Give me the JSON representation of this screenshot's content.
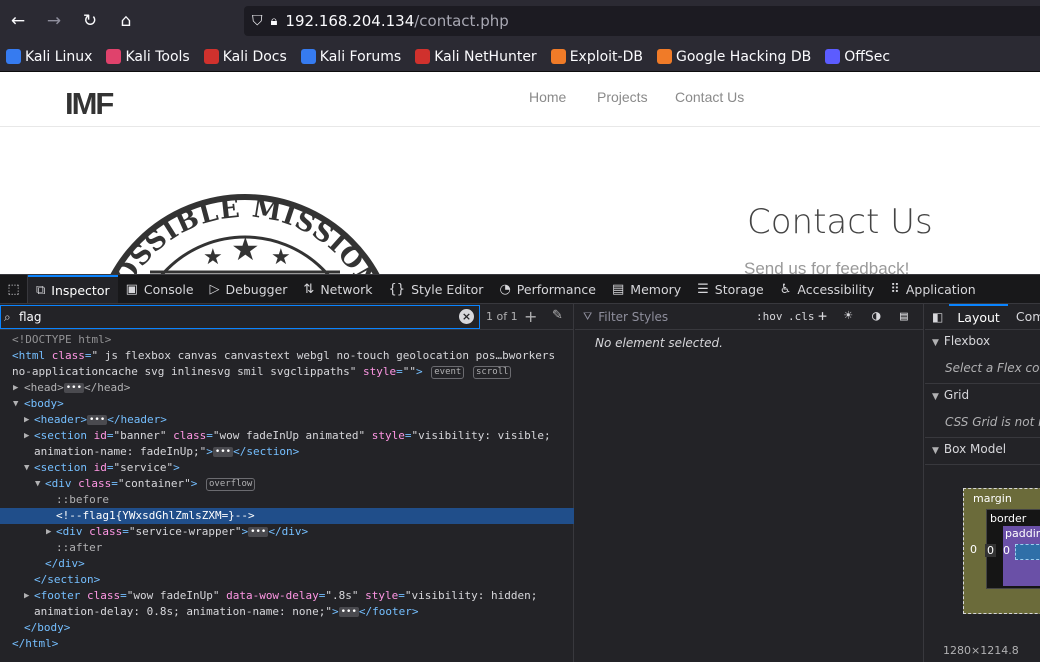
{
  "browser": {
    "url_host": "192.168.204.134",
    "url_path": "/contact.php",
    "bookmarks": [
      {
        "label": "Kali Linux",
        "color": "#367bf0"
      },
      {
        "label": "Kali Tools",
        "color": "#e0426c"
      },
      {
        "label": "Kali Docs",
        "color": "#d0312d"
      },
      {
        "label": "Kali Forums",
        "color": "#367bf0"
      },
      {
        "label": "Kali NetHunter",
        "color": "#d0312d"
      },
      {
        "label": "Exploit-DB",
        "color": "#f07b28"
      },
      {
        "label": "Google Hacking DB",
        "color": "#f07b28"
      },
      {
        "label": "OffSec",
        "color": "#5c5cff"
      }
    ]
  },
  "site": {
    "logo": "IMF",
    "nav": [
      "Home",
      "Projects",
      "Contact Us"
    ],
    "heading": "Contact Us",
    "subheading": "Send us for feedback!",
    "seal_text": "POSSIBLE MISSION FOR"
  },
  "devtools": {
    "tabs": [
      {
        "label": "Inspector",
        "icon": "inspector-icon",
        "glyph": "⧉"
      },
      {
        "label": "Console",
        "icon": "console-icon",
        "glyph": "▣"
      },
      {
        "label": "Debugger",
        "icon": "debugger-icon",
        "glyph": "▷"
      },
      {
        "label": "Network",
        "icon": "network-icon",
        "glyph": "⇅"
      },
      {
        "label": "Style Editor",
        "icon": "style-editor-icon",
        "glyph": "{}"
      },
      {
        "label": "Performance",
        "icon": "performance-icon",
        "glyph": "◔"
      },
      {
        "label": "Memory",
        "icon": "memory-icon",
        "glyph": "▤"
      },
      {
        "label": "Storage",
        "icon": "storage-icon",
        "glyph": "☰"
      },
      {
        "label": "Accessibility",
        "icon": "accessibility-icon",
        "glyph": "♿"
      },
      {
        "label": "Application",
        "icon": "application-icon",
        "glyph": "⠿"
      }
    ],
    "search_value": "flag",
    "match_count": "1 of 1",
    "filter_placeholder": "Filter Styles",
    "hov": ":hov",
    "cls": ".cls",
    "no_element": "No element selected.",
    "layout_tabs": [
      "Layout",
      "Com"
    ],
    "flexbox_title": "Flexbox",
    "flexbox_msg": "Select a Flex conta",
    "grid_title": "Grid",
    "grid_msg": "CSS Grid is not in",
    "boxmodel_title": "Box Model",
    "bm_margin": "margin",
    "bm_border": "border",
    "bm_padding": "paddin",
    "bm_zero": "0",
    "dims": "1280×1214.8",
    "tree": {
      "doctype": "<!DOCTYPE html>",
      "html_attr_val_1": "\" js flexbox canvas canvastext webgl no-touch geolocation pos…bworkers",
      "html_attr_val_2": "no-applicationcache svg inlinesvg smil svgclippaths\"",
      "badge_event": "event",
      "badge_scroll": "scroll",
      "badge_overflow": "overflow",
      "banner_style_1": "\"visibility: visible;",
      "banner_style_2": "animation-name: fadeInUp;\"",
      "comment": "<!--flag1{YWxsdGhlZmlsZXM=}-->",
      "footer_delay": "\".8s\"",
      "footer_style_1": "\"visibility: hidden;",
      "footer_style_2": "animation-delay: 0.8s; animation-name: none;\""
    }
  }
}
